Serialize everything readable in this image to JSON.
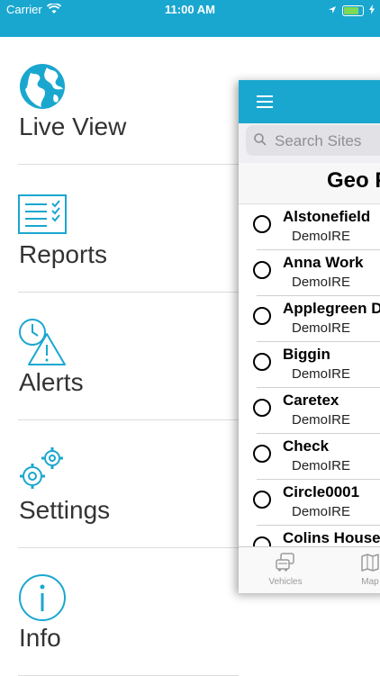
{
  "status_bar": {
    "carrier": "Carrier",
    "time": "11:00 AM",
    "battery_level": 0.9
  },
  "menu": {
    "items": [
      {
        "label": "Live View",
        "icon": "globe-icon"
      },
      {
        "label": "Reports",
        "icon": "checklist-icon"
      },
      {
        "label": "Alerts",
        "icon": "clock-warning-icon"
      },
      {
        "label": "Settings",
        "icon": "gears-icon"
      },
      {
        "label": "Info",
        "icon": "info-icon"
      }
    ]
  },
  "panel": {
    "search": {
      "placeholder": "Search Sites"
    },
    "title": "Geo F",
    "sites": [
      {
        "name": "Alstonefield",
        "group": "DemoIRE"
      },
      {
        "name": "Anna Work",
        "group": "DemoIRE"
      },
      {
        "name": "Applegreen Du",
        "group": "DemoIRE"
      },
      {
        "name": "Biggin",
        "group": "DemoIRE"
      },
      {
        "name": "Caretex",
        "group": "DemoIRE"
      },
      {
        "name": "Check",
        "group": "DemoIRE"
      },
      {
        "name": "Circle0001",
        "group": "DemoIRE"
      },
      {
        "name": "Colins House",
        "group": ""
      }
    ],
    "tabs": [
      {
        "label": "Vehicles",
        "icon": "vehicles-icon"
      },
      {
        "label": "Map",
        "icon": "map-icon"
      }
    ]
  },
  "colors": {
    "accent": "#1aa7cf",
    "text": "#333333"
  }
}
